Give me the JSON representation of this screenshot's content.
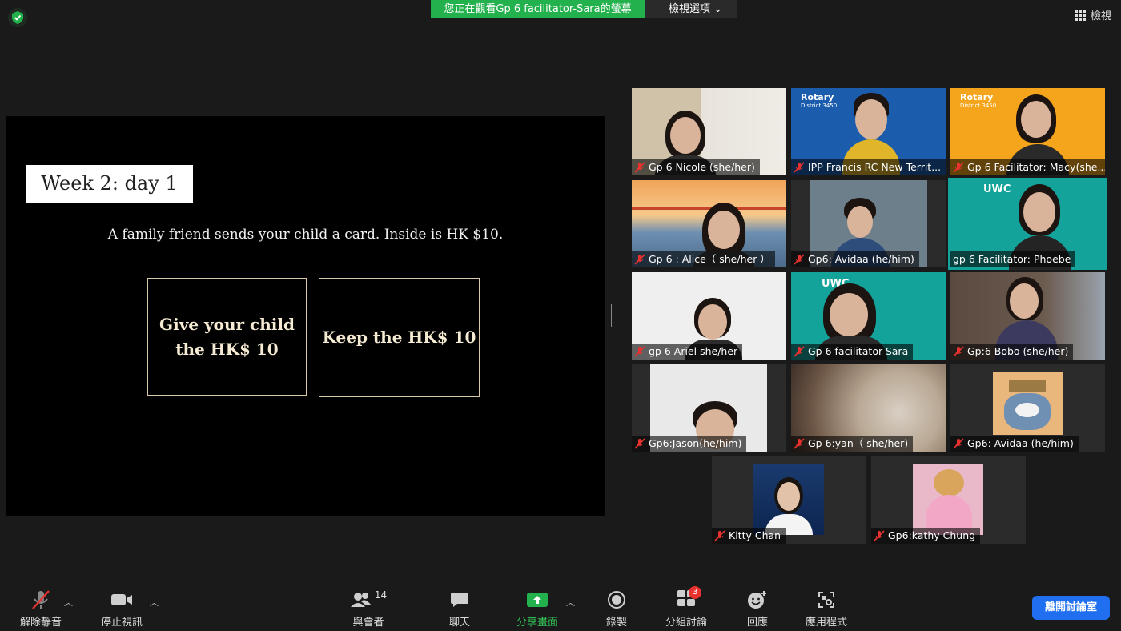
{
  "topbar": {
    "viewing_banner": "您正在觀看Gp 6 facilitator-Sara的螢幕",
    "view_options": "檢視選項",
    "view_button": "檢視"
  },
  "slide": {
    "title": "Week 2: day 1",
    "prompt": "A family friend sends your child a card. Inside is HK $10.",
    "choice_a": "Give your child the HK$ 10",
    "choice_b": "Keep the HK$ 10"
  },
  "participants": [
    {
      "name": "Gp 6 Nicole (she/her)"
    },
    {
      "name": "IPP Francis RC New Territ..."
    },
    {
      "name": "Gp 6 Facilitator: Macy(she..."
    },
    {
      "name": "Gp 6 : Alice（ she/her ）"
    },
    {
      "name": "Gp6: Avidaa (he/him)"
    },
    {
      "name": "gp 6 Facilitator: Phoebe"
    },
    {
      "name": "gp 6 Ariel she/her"
    },
    {
      "name": "Gp 6 facilitator-Sara"
    },
    {
      "name": "Gp:6 Bobo (she/her)"
    },
    {
      "name": "Gp6:Jason(he/him)"
    },
    {
      "name": "Gp 6:yan（ she/her)"
    },
    {
      "name": "Gp6: Avidaa (he/him)"
    },
    {
      "name": "Kitty Chan"
    },
    {
      "name": "Gp6:kathy Chung"
    }
  ],
  "tile_logos": {
    "rotary": "Rotary",
    "rotary_district": "District 3450",
    "uwc": "UWC"
  },
  "toolbar": {
    "unmute": "解除靜音",
    "stop_video": "停止視訊",
    "participants": "與會者",
    "participants_count": "14",
    "chat": "聊天",
    "share_screen": "分享畫面",
    "record": "錄製",
    "breakout": "分組討論",
    "breakout_count": "3",
    "reactions": "回應",
    "apps": "應用程式",
    "leave": "離開討論室"
  },
  "colors": {
    "banner_green": "#23b14d",
    "active_speaker": "#d6e85a",
    "leave_blue": "#1f6ff0",
    "mute_red": "#e8322f"
  }
}
